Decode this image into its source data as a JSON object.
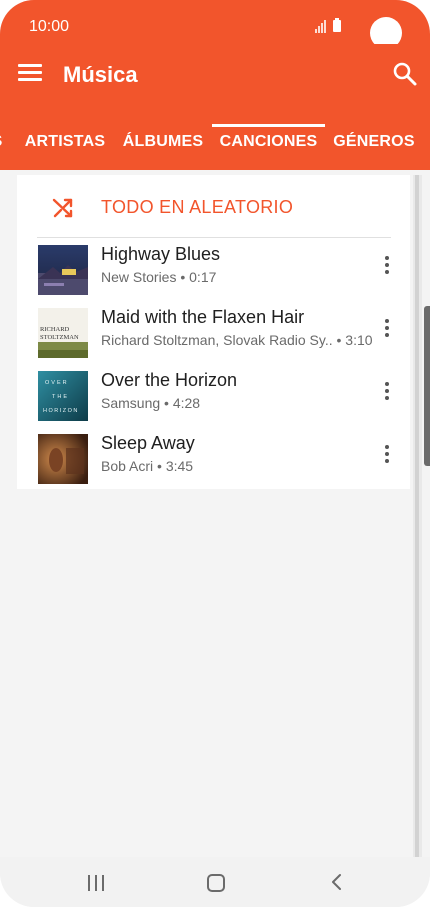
{
  "status_bar": {
    "time": "10:00"
  },
  "app_bar": {
    "title": "Música"
  },
  "tabs": [
    {
      "label": "S"
    },
    {
      "label": "ARTISTAS"
    },
    {
      "label": "ÁLBUMES"
    },
    {
      "label": "CANCIONES"
    },
    {
      "label": "GÉNEROS"
    }
  ],
  "shuffle": {
    "label": "TODO EN ALEATORIO"
  },
  "songs": [
    {
      "title": "Highway Blues",
      "meta": "New Stories • 0:17"
    },
    {
      "title": "Maid with the Flaxen Hair",
      "meta": "Richard Stoltzman, Slovak Radio Sy..  • 3:10"
    },
    {
      "title": "Over the Horizon",
      "meta": "Samsung • 4:28"
    },
    {
      "title": "Sleep Away",
      "meta": "Bob Acri • 3:45"
    }
  ],
  "album_art": [
    {
      "name": "highway-blues-art"
    },
    {
      "name": "maid-flaxen-hair-art",
      "text": "RICHARD STOLTZMAN"
    },
    {
      "name": "over-the-horizon-art",
      "text": "OVER THE HORIZON"
    },
    {
      "name": "sleep-away-art"
    }
  ],
  "icons": {
    "menu": "menu-icon",
    "search": "search-icon",
    "shuffle": "shuffle-icon",
    "more": "more-vert-icon",
    "signal": "signal-icon",
    "battery": "battery-icon",
    "recents": "recents-icon",
    "home": "home-icon",
    "back": "back-icon"
  },
  "colors": {
    "accent": "#f2552c",
    "background": "#f4f4f4",
    "card": "#ffffff",
    "primary_text": "#202020",
    "secondary_text": "#6a6a6a"
  }
}
